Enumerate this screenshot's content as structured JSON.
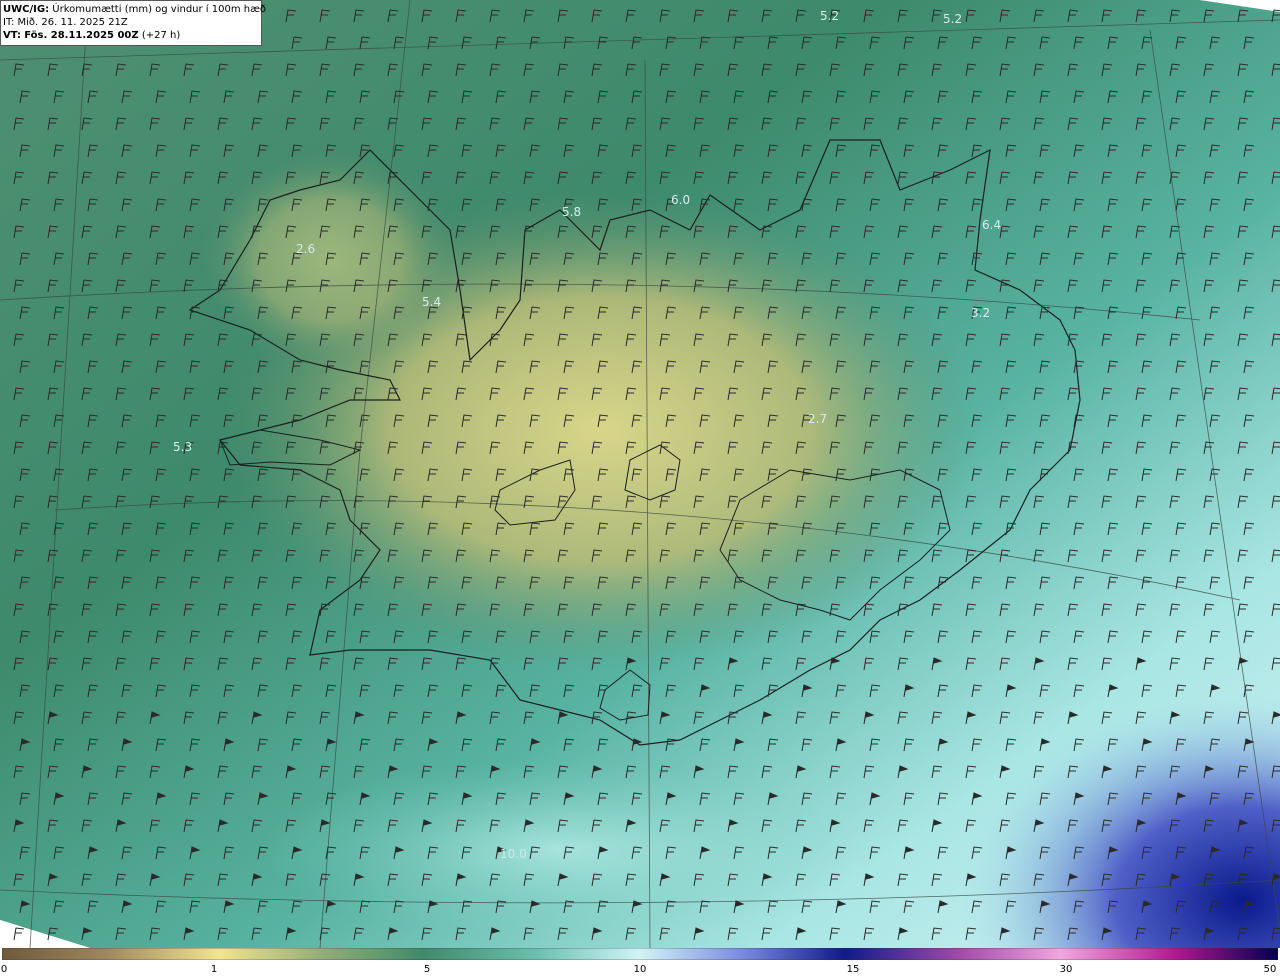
{
  "header": {
    "product_code": "UWC/IG:",
    "title": "Úrkomumætti (mm) og vindur í 100m hæð",
    "init_label": "IT:",
    "init_time": "Mið. 26. 11. 2025 21Z",
    "valid_label": "VT:",
    "valid_time": "Fös. 28.11.2025 00Z",
    "lead": "(+27 h)"
  },
  "map_values": [
    "5.2",
    "5.2",
    "5.8",
    "6.0",
    "6.4",
    "2.6",
    "5.4",
    "3.2",
    "2.7",
    "5.3",
    "10.0"
  ],
  "colorbar": {
    "ticks": [
      "0",
      "1",
      "5",
      "10",
      "15",
      "30",
      "50"
    ],
    "colors": [
      "#6e5a3a",
      "#a8946a",
      "#f2e48e",
      "#8fb07a",
      "#3f8a6a",
      "#2a7a66",
      "#9fe4e0",
      "#c9f2f4",
      "#6a78d8",
      "#101a8a",
      "#c04aa8",
      "#f0a0dc",
      "#b01890",
      "#000050"
    ]
  }
}
